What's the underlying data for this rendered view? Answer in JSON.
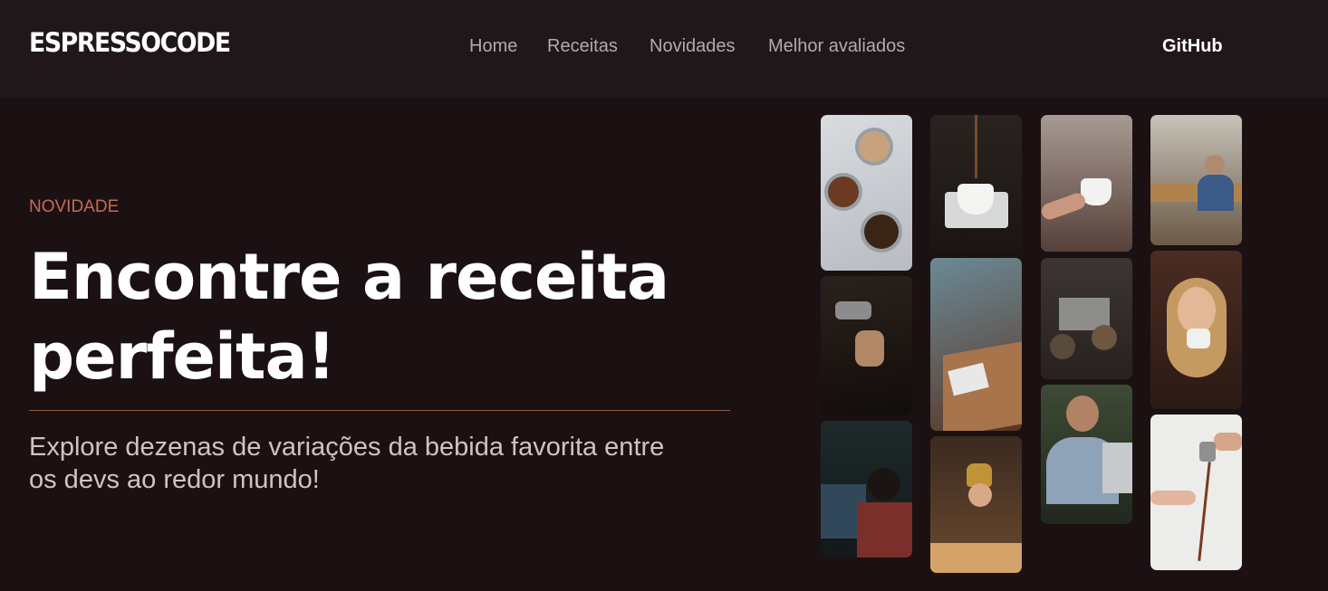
{
  "header": {
    "logo": "ESPRESSOCODE",
    "nav": [
      {
        "label": "Home"
      },
      {
        "label": "Receitas"
      },
      {
        "label": "Novidades"
      },
      {
        "label": "Melhor avaliados"
      }
    ],
    "github_label": "GitHub"
  },
  "hero": {
    "eyebrow": "NOVIDADE",
    "headline_line1": "Encontre a receita",
    "headline_line2": "perfeita!",
    "subtitle_line1": "Explore dezenas de variações da bebida favorita entre",
    "subtitle_line2": "os devs ao redor mundo!"
  },
  "gallery": {
    "images": [
      {
        "name": "portafilters-coffee-photo"
      },
      {
        "name": "latte-art-pouring-photo"
      },
      {
        "name": "developer-at-monitors-photo"
      },
      {
        "name": "coffee-pour-cup-photo"
      },
      {
        "name": "cafe-window-table-photo"
      },
      {
        "name": "barista-woman-photo"
      },
      {
        "name": "steaming-cup-hand-photo"
      },
      {
        "name": "people-at-cafe-bar-photo"
      },
      {
        "name": "man-with-laptop-cup-photo"
      },
      {
        "name": "office-team-photo"
      },
      {
        "name": "woman-drinking-coffee-photo"
      },
      {
        "name": "pouring-coffee-splash-photo"
      }
    ]
  }
}
